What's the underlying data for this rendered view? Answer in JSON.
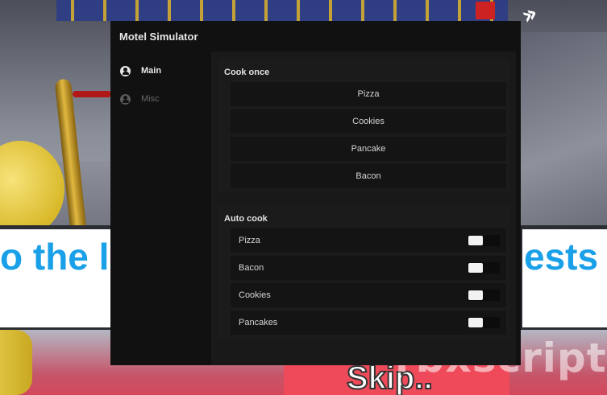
{
  "window": {
    "title": "Motel Simulator"
  },
  "sidebar": {
    "items": [
      {
        "label": "Main",
        "icon": "user-circle-icon",
        "active": true
      },
      {
        "label": "Misc",
        "icon": "user-circle-icon",
        "active": false
      }
    ]
  },
  "cook_once": {
    "title": "Cook once",
    "buttons": [
      "Pizza",
      "Cookies",
      "Pancake",
      "Bacon"
    ]
  },
  "auto_cook": {
    "title": "Auto cook",
    "toggles": [
      {
        "label": "Pizza",
        "on": false
      },
      {
        "label": "Bacon",
        "on": false
      },
      {
        "label": "Cookies",
        "on": false
      },
      {
        "label": "Pancakes",
        "on": false
      }
    ]
  },
  "background": {
    "banner_left": "o the l",
    "banner_right": "ests",
    "skip": "Skip..",
    "watermark": "rbxscript.c"
  },
  "colors": {
    "window_bg": "#111111",
    "content_bg": "#191919",
    "accent_text": "#e8e8e8",
    "banner_text": "#1aa0e8"
  }
}
